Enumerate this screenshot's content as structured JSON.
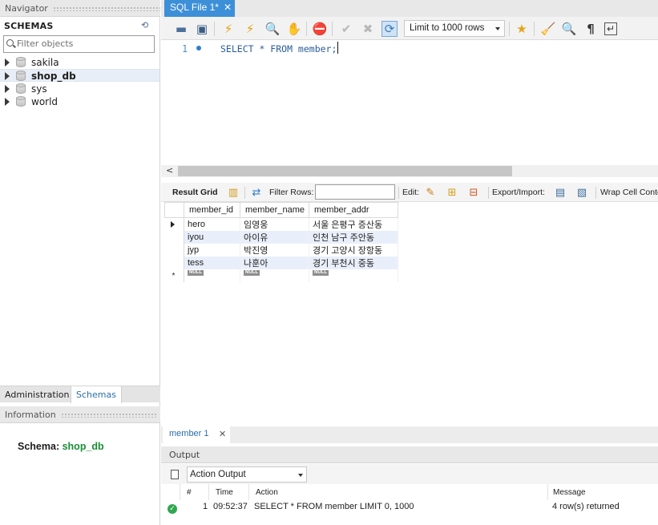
{
  "navigator": {
    "title": "Navigator",
    "schemas_title": "SCHEMAS",
    "filter_placeholder": "Filter objects",
    "schemas": [
      {
        "name": "sakila"
      },
      {
        "name": "shop_db"
      },
      {
        "name": "sys"
      },
      {
        "name": "world"
      }
    ],
    "tabs": {
      "administration": "Administration",
      "schemas": "Schemas"
    },
    "information_title": "Information",
    "schema_label": "Schema:",
    "schema_value": "shop_db"
  },
  "editor": {
    "tab_label": "SQL File 1*",
    "limit_option": "Limit to 1000 rows",
    "line_number": "1",
    "sql": "SELECT * FROM member;"
  },
  "result": {
    "toolbar": {
      "result_grid": "Result Grid",
      "filter_rows": "Filter Rows:",
      "edit": "Edit:",
      "export_import": "Export/Import:",
      "wrap_cell": "Wrap Cell Conte"
    },
    "columns": [
      "member_id",
      "member_name",
      "member_addr"
    ],
    "rows": [
      [
        "hero",
        "임영웅",
        "서울 은평구 증산동"
      ],
      [
        "iyou",
        "아이유",
        "인천 남구 주안동"
      ],
      [
        "jyp",
        "박진영",
        "경기 고양시 장항동"
      ],
      [
        "tess",
        "나훈아",
        "경기 부천시 중동"
      ]
    ],
    "null_label": "NULL",
    "tab_label": "member 1"
  },
  "output": {
    "title": "Output",
    "selector": "Action Output",
    "headers": {
      "num": "#",
      "time": "Time",
      "action": "Action",
      "message": "Message"
    },
    "entries": [
      {
        "num": "1",
        "time": "09:52:37",
        "action": "SELECT * FROM member LIMIT 0, 1000",
        "message": "4 row(s) returned",
        "status": "ok"
      }
    ]
  },
  "colors": {
    "accent": "#3d8fd8",
    "schema_green": "#1b8e34",
    "sql_blue": "#2b5d9a",
    "grid_alt": "#e9effa"
  }
}
